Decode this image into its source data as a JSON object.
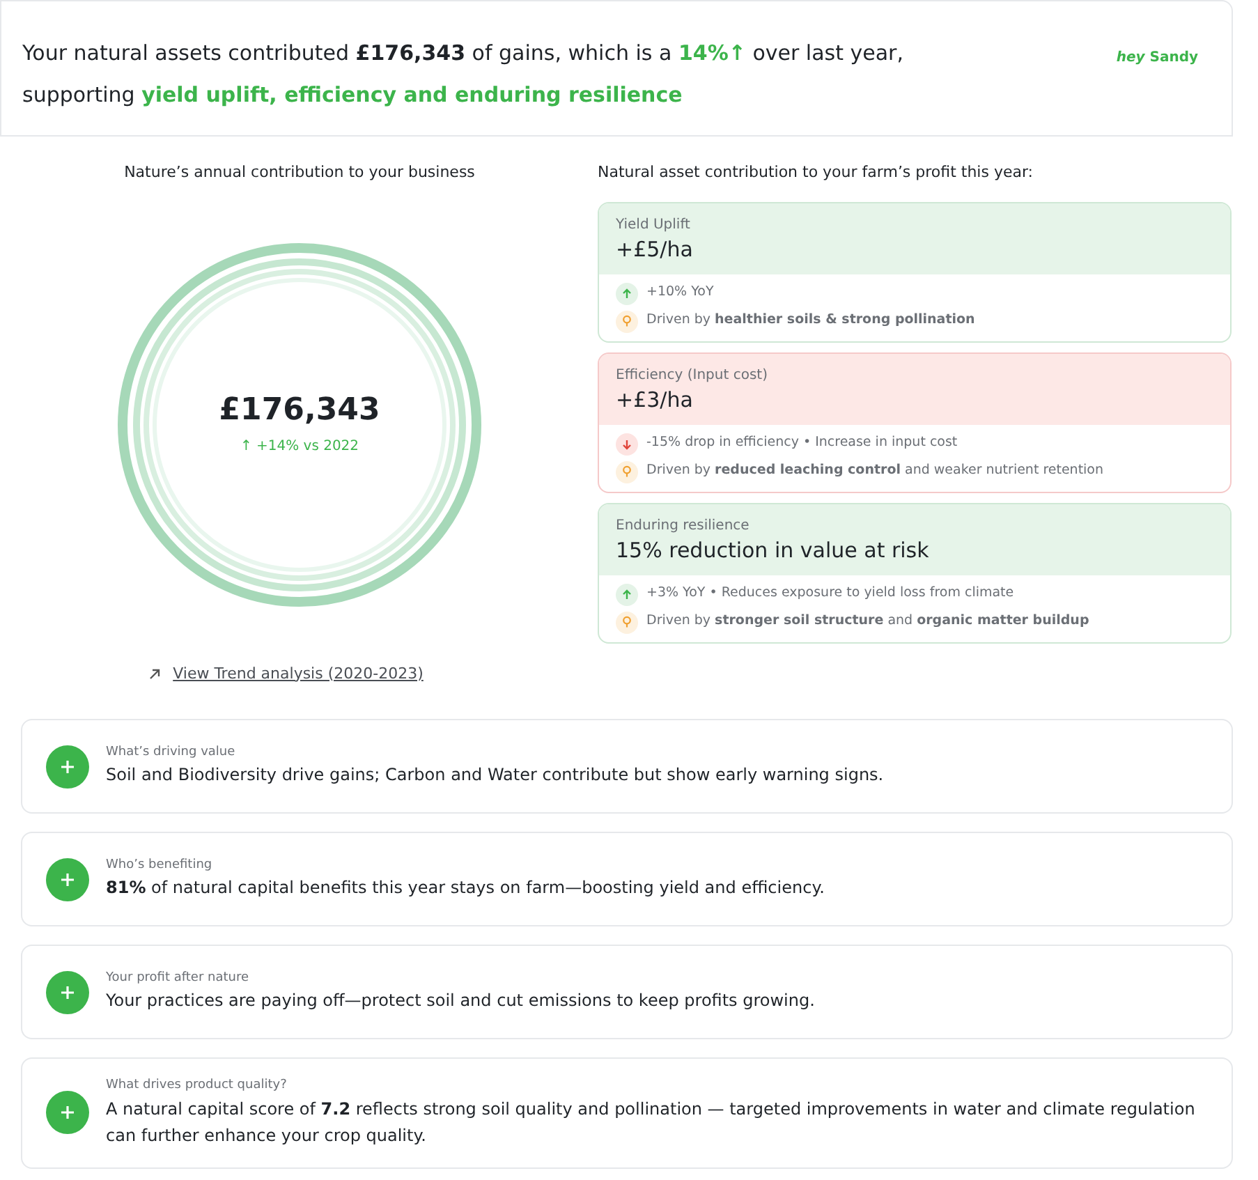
{
  "summary": {
    "lines": [
      [
        {
          "text": "Your natural assets contributed ",
          "kind": "plain"
        },
        {
          "text": "£176,343",
          "kind": "bold"
        },
        {
          "text": " of gains, which is a ",
          "kind": "plain"
        },
        {
          "text": "14%↑",
          "kind": "green"
        },
        {
          "text": " over last year,",
          "kind": "plain"
        }
      ],
      [
        {
          "text": "supporting ",
          "kind": "plain"
        },
        {
          "text": "yield uplift, efficiency and enduring resilience",
          "kind": "green"
        }
      ]
    ],
    "greeting": {
      "prefix": "hey",
      "name": "Sandy"
    }
  },
  "left": {
    "title": "Nature’s annual contribution to your business",
    "total": "£176,343",
    "change": "↑ +14% vs 2022",
    "link": "View Trend analysis (2020-2023)"
  },
  "right": {
    "title": "Natural asset contribution to your farm’s profit this year:",
    "cards": [
      {
        "label": "Yield Uplift",
        "value": "+£5/ha",
        "kind": "positive",
        "trend": {
          "kind": "up",
          "text": "+10% YoY"
        },
        "driver": "Driven by **healthier soils & strong pollination**"
      },
      {
        "label": "Efficiency (Input cost)",
        "value": "+£3/ha",
        "kind": "negative",
        "trend": {
          "kind": "down",
          "text": "-15% drop in efficiency • Increase in input cost"
        },
        "driver": "Driven by **reduced leaching control** and weaker nutrient retention"
      },
      {
        "label": "Enduring resilience",
        "value": "15% reduction in value at risk",
        "kind": "positive",
        "trend": {
          "kind": "up",
          "text": "+3% YoY • Reduces exposure to yield loss from climate"
        },
        "driver": "Driven by **stronger soil structure** and **organic matter buildup**"
      }
    ]
  },
  "insights": [
    {
      "label": "What’s driving value",
      "text": "Soil and Biodiversity drive gains; Carbon and Water contribute but show early warning signs.",
      "expanded": false
    },
    {
      "label": "Who’s benefiting",
      "text": "**81%** of natural capital benefits this year stays on farm—boosting yield and efficiency.",
      "expanded": false
    },
    {
      "label": "Your profit after nature",
      "text": "Your practices are paying off—protect soil and cut emissions to keep profits growing.",
      "expanded": false
    },
    {
      "label": "What drives product quality?",
      "text": "A natural capital score of **7.2** reflects strong soil quality and pollination — targeted improvements in water and climate regulation can further enhance your crop quality.",
      "expanded": false
    }
  ]
}
